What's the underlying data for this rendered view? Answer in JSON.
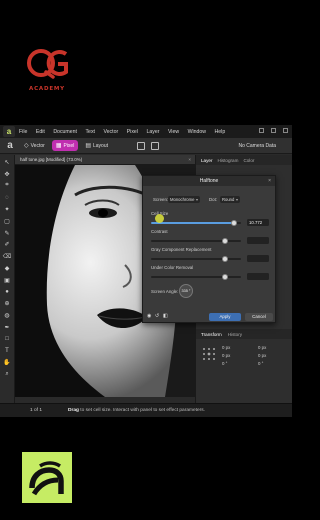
{
  "brand": {
    "academy_text": "ACADEMY",
    "logo_color": "#c8342a",
    "badge_color": "#c6ec64"
  },
  "menubar": {
    "app_icon": "affinity-icon",
    "items": [
      "File",
      "Edit",
      "Document",
      "Text",
      "Vector",
      "Pixel",
      "Layer",
      "View",
      "Window",
      "Help"
    ]
  },
  "toolbar": {
    "personas": [
      {
        "label": "Vector",
        "active": false
      },
      {
        "label": "Pixel",
        "active": true
      },
      {
        "label": "Layout",
        "active": false
      }
    ],
    "camera": "No Camera Data",
    "accent": "#c02fb0"
  },
  "document": {
    "tab_title": "half tone.jpg [Modified] (73.0%)",
    "close": "×"
  },
  "panels": {
    "tabs": [
      "Layer",
      "Histogram",
      "Color"
    ],
    "layer_labels": [
      "HX",
      "Retouched Arts"
    ],
    "transform_tabs": [
      "Transform",
      "History"
    ],
    "transform_values": [
      "0 px",
      "0 px",
      "0 °",
      "0 px",
      "0 px",
      "0 °"
    ]
  },
  "dialog": {
    "title": "Halftone",
    "close": "×",
    "screen_label": "Screen:",
    "screen_value": "Monochrome",
    "dot_label": "Dot:",
    "dot_value": "Round",
    "cell_size_label": "Cell Size",
    "cell_size_value": "10.772",
    "cell_size_level": 0.92,
    "contrast_label": "Contrast",
    "contrast_level": 0.82,
    "gray_label": "Gray Component Replacement",
    "gray_level": 0.82,
    "undercolor_label": "Under Color Removal",
    "undercolor_level": 0.82,
    "angle_label": "Screen Angle:",
    "angle_value": "335 °",
    "apply": "Apply",
    "cancel": "Cancel"
  },
  "status": {
    "pager": "1 of 1",
    "message_bold": "Drag",
    "message": "to set cell size. Interact with panel to set effect parameters."
  }
}
